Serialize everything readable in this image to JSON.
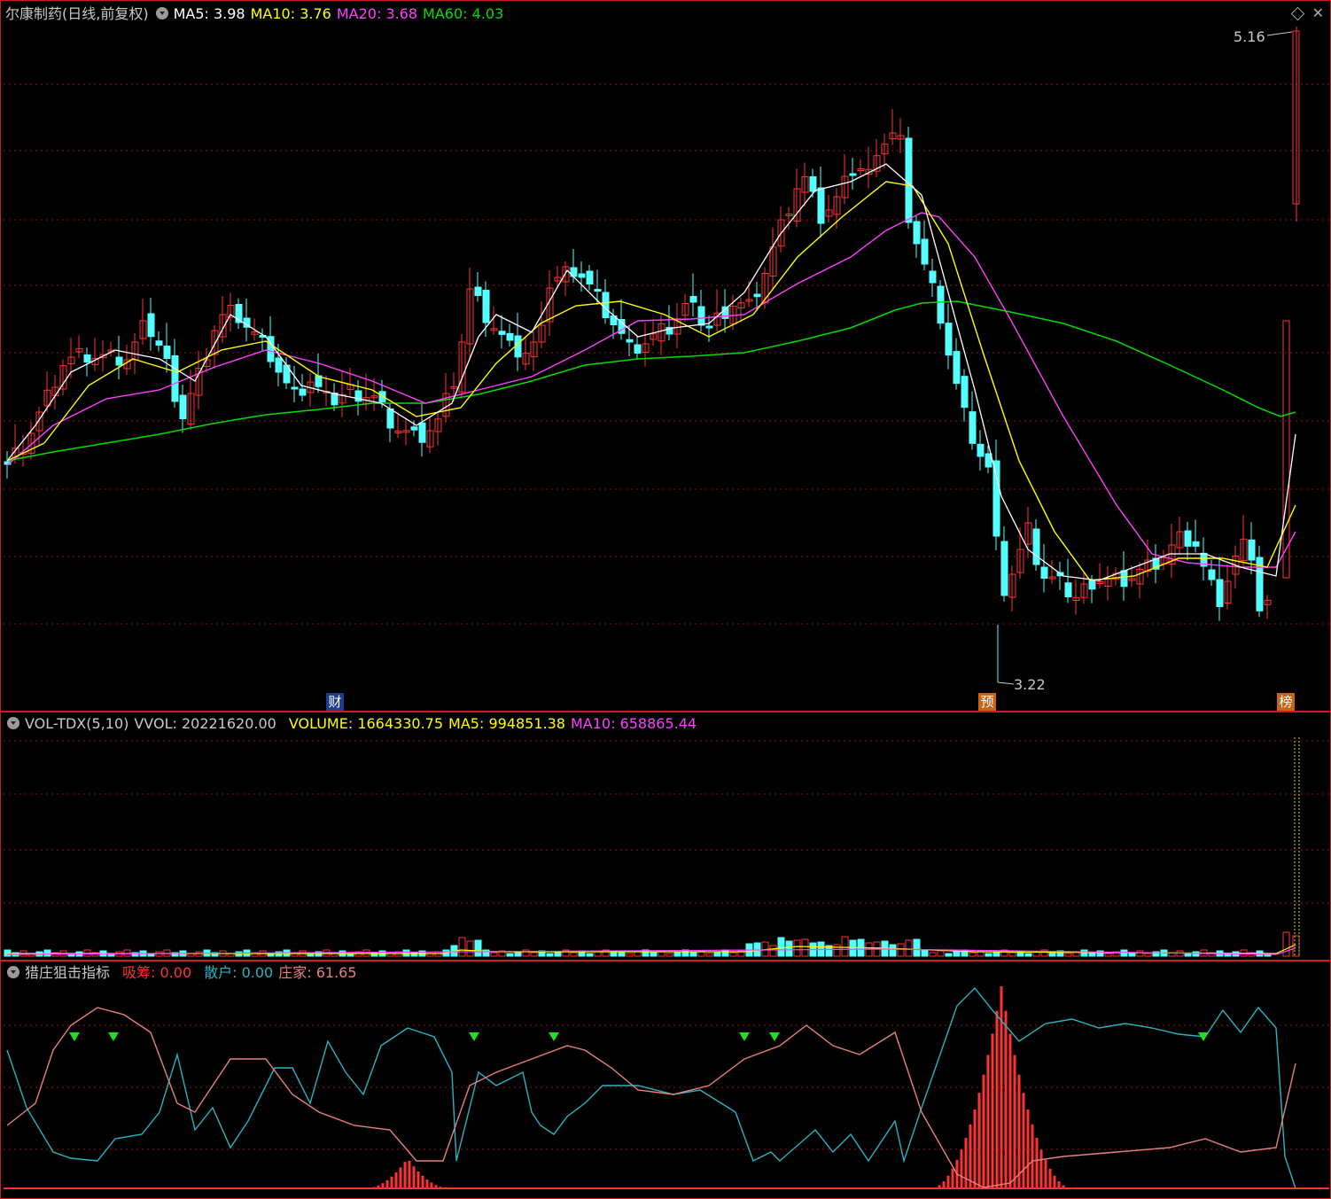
{
  "stock_title": "尔康制药(日线,前复权)",
  "main_header": {
    "ma5": "MA5: 3.98",
    "ma10": "MA10: 3.76",
    "ma20": "MA20: 3.68",
    "ma60": "MA60: 4.03"
  },
  "high_label": "5.16",
  "low_label": "3.22",
  "badges": {
    "cai": "财",
    "yu": "预",
    "bang": "榜"
  },
  "vol_header": {
    "name": "VOL-TDX(5,10)",
    "vvol": "VVOL: 20221620.00",
    "volume": "VOLUME: 1664330.75",
    "ma5": "MA5: 994851.38",
    "ma10": "MA10: 658865.44"
  },
  "ind_header": {
    "name": "猎庄狙击指标",
    "xichou": "吸筹: 0.00",
    "sanhu": "散户: 0.00",
    "zhuangjia": "庄家: 61.65"
  },
  "colors": {
    "up": "#ff3232",
    "down": "#54ffff",
    "ma5": "#ffffff",
    "ma10": "#ffff00",
    "ma20": "#ff40ff",
    "ma60": "#00dc00",
    "grid": "#8c1414",
    "sanhu_line": "#2ab2c0",
    "zhuangjia_line": "#e88080",
    "arrow": "#22dd22"
  },
  "chart_data": [
    {
      "type": "candlestick",
      "title": "尔康制药(日线,前复权)",
      "price_range": [
        3.22,
        5.16
      ],
      "annotations": [
        "5.16",
        "3.22"
      ],
      "series": [
        {
          "name": "MA5",
          "last": 3.98
        },
        {
          "name": "MA10",
          "last": 3.76
        },
        {
          "name": "MA20",
          "last": 3.68
        },
        {
          "name": "MA60",
          "last": 4.03
        }
      ],
      "grid": true
    },
    {
      "type": "bar",
      "title": "VOL-TDX(5,10)",
      "series": [
        {
          "name": "VVOL",
          "last": 20221620.0
        },
        {
          "name": "VOLUME",
          "last": 1664330.75
        },
        {
          "name": "MA5",
          "last": 994851.38
        },
        {
          "name": "MA10",
          "last": 658865.44
        }
      ],
      "grid": true
    },
    {
      "type": "line",
      "title": "猎庄狙击指标",
      "series": [
        {
          "name": "吸筹",
          "last": 0.0
        },
        {
          "name": "散户",
          "last": 0.0
        },
        {
          "name": "庄家",
          "last": 61.65
        }
      ],
      "grid": true
    }
  ]
}
